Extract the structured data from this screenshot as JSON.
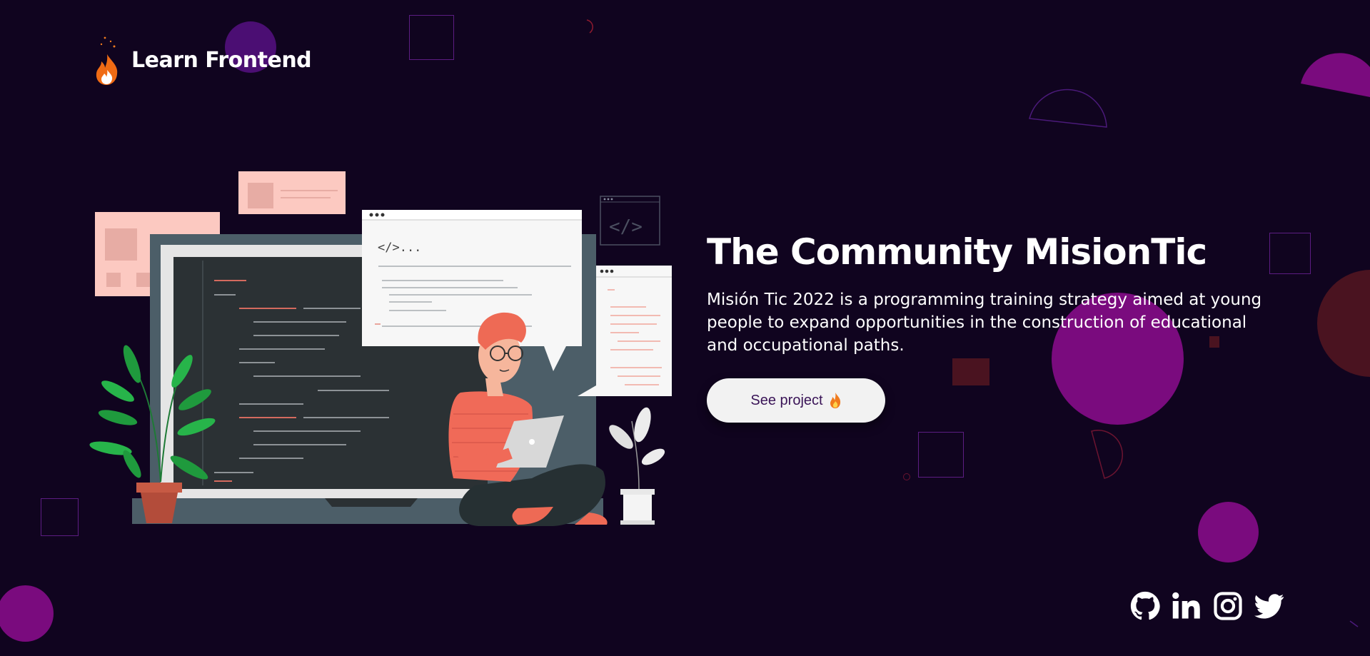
{
  "brand": {
    "title": "Learn Frontend",
    "logo_icon": "fire-icon"
  },
  "hero": {
    "title": "The Community MisionTic",
    "description": "Misión Tic 2022 is a programming training strategy aimed at young people to expand opportunities in the construction of educational and occupational paths.",
    "cta_label": "See project",
    "cta_icon": "fire-icon"
  },
  "illustration": {
    "code_tag": "</>...",
    "code_icon": "</>"
  },
  "social": [
    {
      "name": "github",
      "icon": "github-icon"
    },
    {
      "name": "linkedin",
      "icon": "linkedin-icon"
    },
    {
      "name": "instagram",
      "icon": "instagram-icon"
    },
    {
      "name": "twitter",
      "icon": "twitter-icon"
    }
  ],
  "colors": {
    "background": "#10041f",
    "accent_purple": "#7a0b7e",
    "accent_maroon": "#4a1320",
    "text": "#ffffff",
    "button_bg": "#f2f2f2",
    "button_text": "#3a1457"
  }
}
